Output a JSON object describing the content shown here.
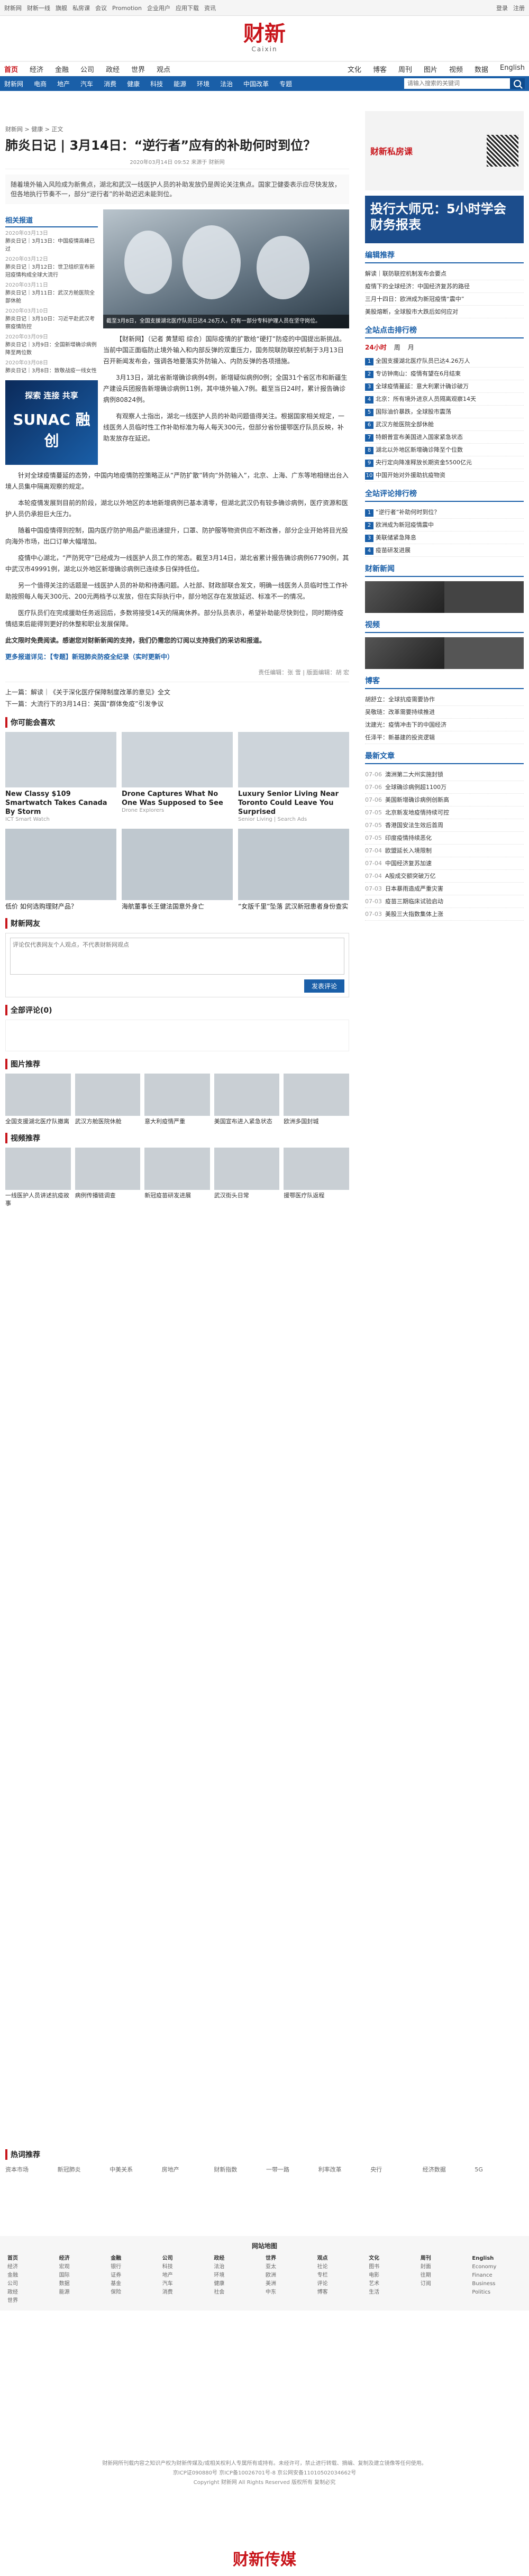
{
  "topbar": {
    "left": [
      "财新网",
      "财新一线",
      "旗舰",
      "私房课",
      "会议",
      "Promotion",
      "企业用户",
      "应用下载",
      "资讯"
    ],
    "right": [
      "登录",
      "注册"
    ]
  },
  "logo": {
    "cn": "财新",
    "en": "Caixin"
  },
  "nav1": {
    "items": [
      "首页",
      "经济",
      "金融",
      "公司",
      "政经",
      "世界",
      "观点"
    ],
    "right": [
      "文化",
      "博客",
      "周刊",
      "图片",
      "视频",
      "数据",
      "English"
    ]
  },
  "nav2": {
    "items": [
      "财新网",
      "电商",
      "地产",
      "汽车",
      "消费",
      "健康",
      "科技",
      "能源",
      "环境",
      "法治",
      "中国改革",
      "专题"
    ],
    "placeholder": "请输入搜索的关键词"
  },
  "article": {
    "crumb": "财新网 > 健康 > 正文",
    "title": "肺炎日记 | 3月14日：“逆行者”应有的补助何时到位？",
    "meta": "2020年03月14日 09:52 来源于 财新网",
    "summary": "随着境外输入风险成为新焦点，湖北和武汉一线医护人员的补助发放仍是舆论关注焦点。国家卫健委表示应尽快发放，但各地执行节奏不一，部分“逆行者”的补助迟迟未能到位。",
    "hero_caption": "截至3月8日，全国支援湖北医疗队员已达4.26万人，仍有一部分专科护理人员在坚守岗位。",
    "p1": "【财新网】（记者 黄慧昭 综合）国际疫情的扩散给“硬打”防疫的中国提出新挑战。当前中国正面临防止境外输入和内部反弹的双重压力，国务院联防联控机制于3月13日召开新闻发布会，强调各地要落实外防输入、内防反弹的各项措施。",
    "p2": "3月13日，湖北省新增确诊病例4例，新增疑似病例0例；全国31个省区市和新疆生产建设兵团报告新增确诊病例11例，其中境外输入7例。截至当日24时，累计报告确诊病例80824例。",
    "p3": "有观察人士指出，湖北一线医护人员的补助问题值得关注。根据国家相关规定，一线医务人员临时性工作补助标准为每人每天300元，但部分省份援鄂医疗队员反映，补助发放存在延迟。",
    "p4": "针对全球疫情蔓延的态势，中国内地疫情防控策略正从“严防扩散”转向“外防输入”，北京、上海、广东等地相继出台入境人员集中隔离观察的规定。",
    "p5": "本轮疫情发展到目前的阶段，湖北以外地区的本地新增病例已基本清零，但湖北武汉仍有较多确诊病例，医疗资源和医护人员仍承担巨大压力。",
    "p6": "随着中国疫情得到控制，国内医疗防护用品产能迅速提升，口罩、防护服等物资供应不断改善，部分企业开始将目光投向海外市场，出口订单大幅增加。",
    "p7": "疫情中心湖北，“严防死守”已经成为一线医护人员工作的常态。截至3月14日，湖北省累计报告确诊病例67790例，其中武汉市49991例，湖北以外地区新增确诊病例已连续多日保持低位。",
    "p8": "另一个值得关注的话题是一线医护人员的补助和待遇问题。人社部、财政部联合发文，明确一线医务人员临时性工作补助按照每人每天300元、200元两档予以发放，但在实际执行中，部分地区存在发放延迟、标准不一的情况。",
    "p9": "医疗队员们在完成援助任务返回后，多数将接受14天的隔离休养。部分队员表示，希望补助能尽快到位，同时期待疫情结束后能得到更好的休整和职业发展保障。",
    "notice": "此文限时免费阅读。感谢您对财新新闻的支持，我们仍需您的订阅以支持我们的采访和报道。",
    "more": "更多报道详见：【专题】新冠肺炎防疫全纪录（实时更新中）",
    "editor": "责任编辑：张 雪 | 版面编辑：胡 宏",
    "prev": "上一篇：解读｜《关于深化医疗保障制度改革的意见》全文",
    "next": "下一篇：大流行下的3月14日：英国“群体免疫”引发争议"
  },
  "leftcol": {
    "h": "相关报道",
    "items": [
      {
        "d": "2020年03月13日",
        "t": "肺炎日记｜3月13日：中国疫情高峰已过"
      },
      {
        "d": "2020年03月12日",
        "t": "肺炎日记｜3月12日：世卫组织宣布新冠疫情构成全球大流行"
      },
      {
        "d": "2020年03月11日",
        "t": "肺炎日记｜3月11日：武汉方舱医院全部休舱"
      },
      {
        "d": "2020年03月10日",
        "t": "肺炎日记｜3月10日：习近平赴武汉考察疫情防控"
      },
      {
        "d": "2020年03月09日",
        "t": "肺炎日记｜3月9日：全国新增确诊病例降至两位数"
      },
      {
        "d": "2020年03月08日",
        "t": "肺炎日记｜3月8日：致敬战疫一线女性"
      }
    ],
    "ad_t": "探索 连接 共享",
    "ad_big": "SUNAC 融创"
  },
  "sections": {
    "recommend": "你可能会喜欢",
    "comment": "财新网友",
    "news": "全部评论(0)",
    "photos": "图片推荐",
    "video": "视频推荐",
    "hot": "热词推荐",
    "sitemap": "网站地图"
  },
  "taboola": [
    {
      "t": "New Classy $109 Smartwatch Takes Canada By Storm",
      "s": "ICT Smart Watch"
    },
    {
      "t": "Drone Captures What No One Was Supposed to See",
      "s": "Drone Explorers"
    },
    {
      "t": "Luxury Senior Living Near Toronto Could Leave You Surprised",
      "s": "Senior Living | Search Ads"
    }
  ],
  "taboola2": [
    {
      "t": "低价 如何选购理财产品？"
    },
    {
      "t": "海航董事长王健法国意外身亡"
    },
    {
      "t": "“女版千里”坠落 武汉新冠患者身份查实"
    }
  ],
  "comment_placeholder": "评论仅代表网友个人观点，不代表财新网观点",
  "comment_btn": "发表评论",
  "photos": [
    {
      "t": "全国支援湖北医疗队撤离"
    },
    {
      "t": "武汉方舱医院休舱"
    },
    {
      "t": "意大利疫情严重"
    },
    {
      "t": "美国宣布进入紧急状态"
    },
    {
      "t": "欧洲多国封城"
    }
  ],
  "videos": [
    {
      "t": "一线医护人员讲述抗疫故事"
    },
    {
      "t": "病例传播链调查"
    },
    {
      "t": "新冠疫苗研发进展"
    },
    {
      "t": "武汉街头日常"
    },
    {
      "t": "援鄂医疗队返程"
    }
  ],
  "hot": [
    "资本市场",
    "新冠肺炎",
    "中美关系",
    "房地产",
    "财新指数",
    "一带一路",
    "利率改革",
    "央行",
    "经济数据",
    "5G"
  ],
  "side": {
    "ad1": "财新私房课",
    "ad2": "投行大师兄：5小时学会财务报表",
    "h1": "编辑推荐",
    "list1": [
      "解读｜联防联控机制发布会要点",
      "疫情下的全球经济：中国经济复苏的路径",
      "三月十四日：欧洲成为新冠疫情“震中”",
      "美股熔断，全球股市大跌后如何应对"
    ],
    "h2": "全站点击排行榜",
    "tabs": [
      "24小时",
      "周",
      "月"
    ],
    "rank": [
      "全国支援湖北医疗队员已达4.26万人",
      "专访钟南山：疫情有望在6月结束",
      "全球疫情蔓延：意大利累计确诊破万",
      "北京：所有境外进京人员隔离观察14天",
      "国际油价暴跌，全球股市震荡",
      "武汉方舱医院全部休舱",
      "特朗普宣布美国进入国家紧急状态",
      "湖北以外地区新增确诊降至个位数",
      "央行定向降准释放长期资金5500亿元",
      "中国开始对外援助抗疫物资"
    ],
    "h3": "全站评论排行榜",
    "rank2": [
      "“逆行者”补助何时到位？",
      "欧洲成为新冠疫情震中",
      "美联储紧急降息",
      "疫苗研发进展"
    ],
    "h4": "财新新闻",
    "h5": "视频",
    "h6": "博客",
    "blogs": [
      "胡舒立：全球抗疫需要协作",
      "吴敬琏：改革需要持续推进",
      "沈建光：疫情冲击下的中国经济",
      "任泽平：新基建的投资逻辑"
    ],
    "h7": "最新文章",
    "latest": [
      {
        "tm": "07-06",
        "t": "澳洲第二大州实施封锁"
      },
      {
        "tm": "07-06",
        "t": "全球确诊病例超1100万"
      },
      {
        "tm": "07-06",
        "t": "美国新增确诊病例创新高"
      },
      {
        "tm": "07-05",
        "t": "北京新发地疫情持续可控"
      },
      {
        "tm": "07-05",
        "t": "香港国安法生效后首周"
      },
      {
        "tm": "07-05",
        "t": "印度疫情持续恶化"
      },
      {
        "tm": "07-04",
        "t": "欧盟延长入境限制"
      },
      {
        "tm": "07-04",
        "t": "中国经济复苏加速"
      },
      {
        "tm": "07-04",
        "t": "A股成交额突破万亿"
      },
      {
        "tm": "07-03",
        "t": "日本暴雨造成严重灾害"
      },
      {
        "tm": "07-03",
        "t": "疫苗三期临床试验启动"
      },
      {
        "tm": "07-03",
        "t": "美股三大指数集体上涨"
      }
    ]
  },
  "sitemap": [
    {
      "h": "首页",
      "items": [
        "经济",
        "金融",
        "公司",
        "政经",
        "世界"
      ]
    },
    {
      "h": "经济",
      "items": [
        "宏观",
        "国际",
        "数据",
        "能源"
      ]
    },
    {
      "h": "金融",
      "items": [
        "银行",
        "证券",
        "基金",
        "保险"
      ]
    },
    {
      "h": "公司",
      "items": [
        "科技",
        "地产",
        "汽车",
        "消费"
      ]
    },
    {
      "h": "政经",
      "items": [
        "法治",
        "环境",
        "健康",
        "社会"
      ]
    },
    {
      "h": "世界",
      "items": [
        "亚太",
        "欧洲",
        "美洲",
        "中东"
      ]
    },
    {
      "h": "观点",
      "items": [
        "社论",
        "专栏",
        "评论",
        "博客"
      ]
    },
    {
      "h": "文化",
      "items": [
        "图书",
        "电影",
        "艺术",
        "生活"
      ]
    },
    {
      "h": "周刊",
      "items": [
        "封面",
        "往期",
        "订阅"
      ]
    },
    {
      "h": "English",
      "items": [
        "Economy",
        "Finance",
        "Business",
        "Politics"
      ]
    }
  ],
  "copyright": [
    "财新网所刊载内容之知识产权为财新传媒及/或相关权利人专属所有或持有。未经许可，禁止进行转载、摘编、复制及建立镜像等任何使用。",
    "京ICP证090880号 京ICP备10026701号-8 京公网安备11010502034662号",
    "Copyright 财新网 All Rights Reserved 版权所有 复制必究"
  ],
  "footlogo": "财新传媒"
}
